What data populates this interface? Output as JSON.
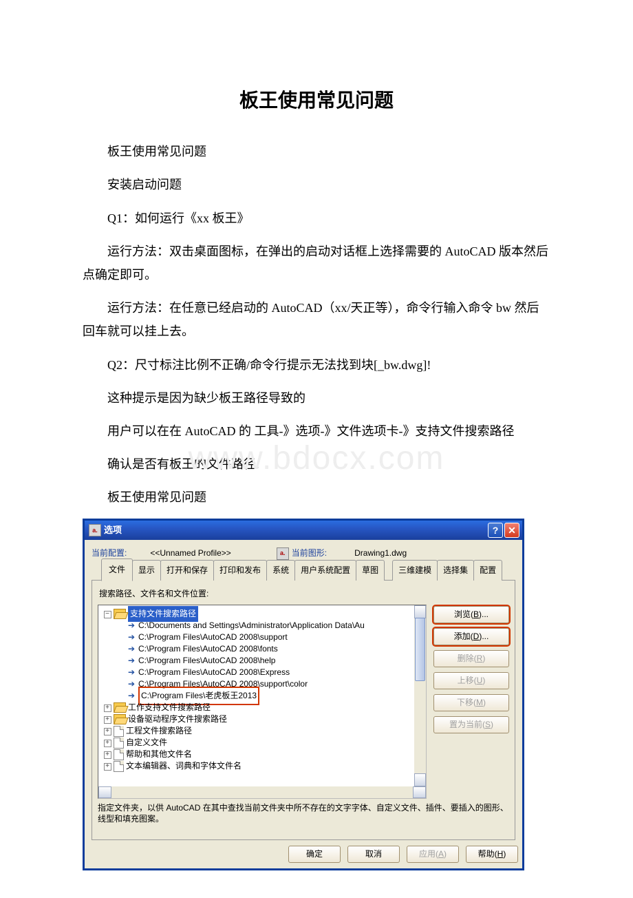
{
  "doc": {
    "title": "板王使用常见问题",
    "p1": "板王使用常见问题",
    "p2": "安装启动问题",
    "p3": "Q1：如何运行《xx 板王》",
    "p4": "运行方法：双击桌面图标，在弹出的启动对话框上选择需要的 AutoCAD 版本然后点确定即可。",
    "p5": "运行方法：在任意已经启动的 AutoCAD（xx/天正等），命令行输入命令 bw 然后回车就可以挂上去。",
    "p6": "Q2：尺寸标注比例不正确/命令行提示无法找到块[_bw.dwg]!",
    "p7": "这种提示是因为缺少板王路径导致的",
    "p8": "用户可以在在 AutoCAD 的 工具-》选项-》文件选项卡-》支持文件搜索路径",
    "p9": " 确认是否有板王的文件路径.",
    "p10": "板王使用常见问题"
  },
  "watermark": "www.bdocx.com",
  "dlg": {
    "title": "选项",
    "profile_label": "当前配置:",
    "profile_value": "<<Unnamed Profile>>",
    "drawing_label": "当前图形:",
    "drawing_value": "Drawing1.dwg",
    "tabs": [
      "文件",
      "显示",
      "打开和保存",
      "打印和发布",
      "系统",
      "用户系统配置",
      "草图",
      "三维建模",
      "选择集",
      "配置"
    ],
    "panel_title": "搜索路径、文件名和文件位置:",
    "tree": {
      "root": "支持文件搜索路径",
      "paths": [
        "C:\\Documents and Settings\\Administrator\\Application Data\\Au",
        "C:\\Program Files\\AutoCAD 2008\\support",
        "C:\\Program Files\\AutoCAD 2008\\fonts",
        "C:\\Program Files\\AutoCAD 2008\\help",
        "C:\\Program Files\\AutoCAD 2008\\Express",
        "C:\\Program Files\\AutoCAD 2008\\support\\color",
        "C:\\Program Files\\老虎板王2013"
      ],
      "folders": [
        "工作支持文件搜索路径",
        "设备驱动程序文件搜索路径",
        "工程文件搜索路径",
        "自定义文件",
        "帮助和其他文件名",
        "文本编辑器、词典和字体文件名"
      ]
    },
    "side": {
      "browse_pre": "浏览(",
      "browse_accel": "B",
      "browse_suf": ")...",
      "add_pre": "添加(",
      "add_accel": "D",
      "add_suf": ")...",
      "del_pre": "删除(",
      "del_accel": "R",
      "del_suf": ")",
      "up_pre": "上移(",
      "up_accel": "U",
      "up_suf": ")",
      "down_pre": "下移(",
      "down_accel": "M",
      "down_suf": ")",
      "cur_pre": "置为当前(",
      "cur_accel": "S",
      "cur_suf": ")"
    },
    "desc": "指定文件夹，以供 AutoCAD 在其中查找当前文件夹中所不存在的文字字体、自定义文件、插件、要插入的图形、线型和填充图案。",
    "bottom": {
      "ok": "确定",
      "cancel": "取消",
      "apply_pre": "应用(",
      "apply_accel": "A",
      "apply_suf": ")",
      "help_pre": "帮助(",
      "help_accel": "H",
      "help_suf": ")"
    }
  }
}
